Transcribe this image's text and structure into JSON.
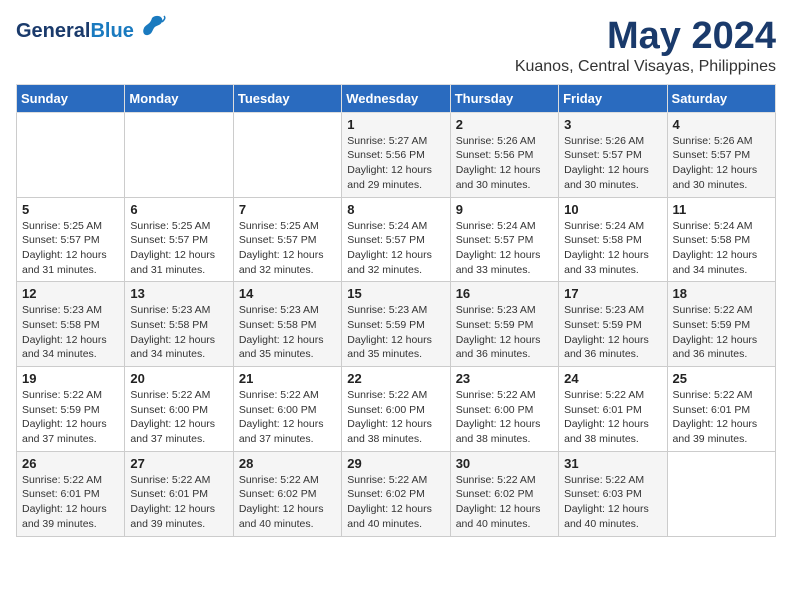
{
  "header": {
    "logo_general": "General",
    "logo_blue": "Blue",
    "month_title": "May 2024",
    "location": "Kuanos, Central Visayas, Philippines"
  },
  "weekdays": [
    "Sunday",
    "Monday",
    "Tuesday",
    "Wednesday",
    "Thursday",
    "Friday",
    "Saturday"
  ],
  "weeks": [
    [
      {
        "day": "",
        "info": ""
      },
      {
        "day": "",
        "info": ""
      },
      {
        "day": "",
        "info": ""
      },
      {
        "day": "1",
        "info": "Sunrise: 5:27 AM\nSunset: 5:56 PM\nDaylight: 12 hours\nand 29 minutes."
      },
      {
        "day": "2",
        "info": "Sunrise: 5:26 AM\nSunset: 5:56 PM\nDaylight: 12 hours\nand 30 minutes."
      },
      {
        "day": "3",
        "info": "Sunrise: 5:26 AM\nSunset: 5:57 PM\nDaylight: 12 hours\nand 30 minutes."
      },
      {
        "day": "4",
        "info": "Sunrise: 5:26 AM\nSunset: 5:57 PM\nDaylight: 12 hours\nand 30 minutes."
      }
    ],
    [
      {
        "day": "5",
        "info": "Sunrise: 5:25 AM\nSunset: 5:57 PM\nDaylight: 12 hours\nand 31 minutes."
      },
      {
        "day": "6",
        "info": "Sunrise: 5:25 AM\nSunset: 5:57 PM\nDaylight: 12 hours\nand 31 minutes."
      },
      {
        "day": "7",
        "info": "Sunrise: 5:25 AM\nSunset: 5:57 PM\nDaylight: 12 hours\nand 32 minutes."
      },
      {
        "day": "8",
        "info": "Sunrise: 5:24 AM\nSunset: 5:57 PM\nDaylight: 12 hours\nand 32 minutes."
      },
      {
        "day": "9",
        "info": "Sunrise: 5:24 AM\nSunset: 5:57 PM\nDaylight: 12 hours\nand 33 minutes."
      },
      {
        "day": "10",
        "info": "Sunrise: 5:24 AM\nSunset: 5:58 PM\nDaylight: 12 hours\nand 33 minutes."
      },
      {
        "day": "11",
        "info": "Sunrise: 5:24 AM\nSunset: 5:58 PM\nDaylight: 12 hours\nand 34 minutes."
      }
    ],
    [
      {
        "day": "12",
        "info": "Sunrise: 5:23 AM\nSunset: 5:58 PM\nDaylight: 12 hours\nand 34 minutes."
      },
      {
        "day": "13",
        "info": "Sunrise: 5:23 AM\nSunset: 5:58 PM\nDaylight: 12 hours\nand 34 minutes."
      },
      {
        "day": "14",
        "info": "Sunrise: 5:23 AM\nSunset: 5:58 PM\nDaylight: 12 hours\nand 35 minutes."
      },
      {
        "day": "15",
        "info": "Sunrise: 5:23 AM\nSunset: 5:59 PM\nDaylight: 12 hours\nand 35 minutes."
      },
      {
        "day": "16",
        "info": "Sunrise: 5:23 AM\nSunset: 5:59 PM\nDaylight: 12 hours\nand 36 minutes."
      },
      {
        "day": "17",
        "info": "Sunrise: 5:23 AM\nSunset: 5:59 PM\nDaylight: 12 hours\nand 36 minutes."
      },
      {
        "day": "18",
        "info": "Sunrise: 5:22 AM\nSunset: 5:59 PM\nDaylight: 12 hours\nand 36 minutes."
      }
    ],
    [
      {
        "day": "19",
        "info": "Sunrise: 5:22 AM\nSunset: 5:59 PM\nDaylight: 12 hours\nand 37 minutes."
      },
      {
        "day": "20",
        "info": "Sunrise: 5:22 AM\nSunset: 6:00 PM\nDaylight: 12 hours\nand 37 minutes."
      },
      {
        "day": "21",
        "info": "Sunrise: 5:22 AM\nSunset: 6:00 PM\nDaylight: 12 hours\nand 37 minutes."
      },
      {
        "day": "22",
        "info": "Sunrise: 5:22 AM\nSunset: 6:00 PM\nDaylight: 12 hours\nand 38 minutes."
      },
      {
        "day": "23",
        "info": "Sunrise: 5:22 AM\nSunset: 6:00 PM\nDaylight: 12 hours\nand 38 minutes."
      },
      {
        "day": "24",
        "info": "Sunrise: 5:22 AM\nSunset: 6:01 PM\nDaylight: 12 hours\nand 38 minutes."
      },
      {
        "day": "25",
        "info": "Sunrise: 5:22 AM\nSunset: 6:01 PM\nDaylight: 12 hours\nand 39 minutes."
      }
    ],
    [
      {
        "day": "26",
        "info": "Sunrise: 5:22 AM\nSunset: 6:01 PM\nDaylight: 12 hours\nand 39 minutes."
      },
      {
        "day": "27",
        "info": "Sunrise: 5:22 AM\nSunset: 6:01 PM\nDaylight: 12 hours\nand 39 minutes."
      },
      {
        "day": "28",
        "info": "Sunrise: 5:22 AM\nSunset: 6:02 PM\nDaylight: 12 hours\nand 40 minutes."
      },
      {
        "day": "29",
        "info": "Sunrise: 5:22 AM\nSunset: 6:02 PM\nDaylight: 12 hours\nand 40 minutes."
      },
      {
        "day": "30",
        "info": "Sunrise: 5:22 AM\nSunset: 6:02 PM\nDaylight: 12 hours\nand 40 minutes."
      },
      {
        "day": "31",
        "info": "Sunrise: 5:22 AM\nSunset: 6:03 PM\nDaylight: 12 hours\nand 40 minutes."
      },
      {
        "day": "",
        "info": ""
      }
    ]
  ]
}
